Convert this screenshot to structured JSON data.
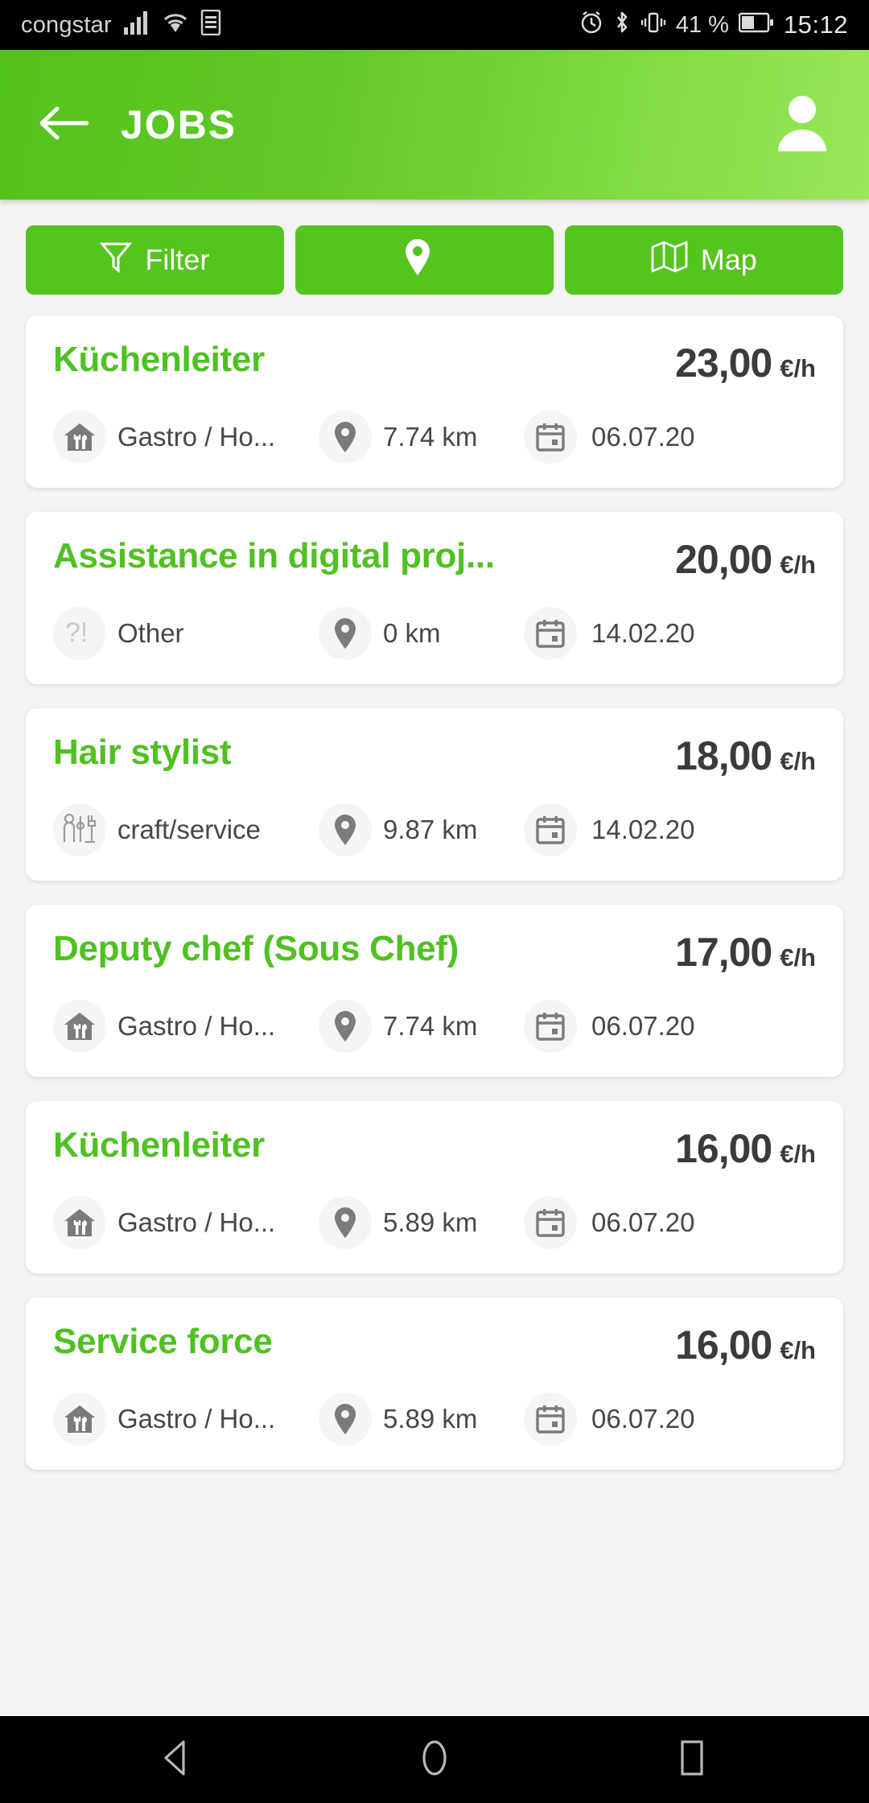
{
  "statusbar": {
    "carrier": "congstar",
    "battery_percent": "41 %",
    "clock": "15:12",
    "icons": [
      "signal-bars-icon",
      "wifi-icon",
      "sim-card-icon",
      "alarm-icon",
      "bluetooth-icon",
      "vibrate-icon",
      "battery-icon"
    ]
  },
  "appbar": {
    "title": "JOBS",
    "back_icon": "back-arrow-icon",
    "profile_icon": "person-icon"
  },
  "toolbar": {
    "filter_label": "Filter",
    "filter_icon": "funnel-icon",
    "location_icon": "map-pin-icon",
    "location_label": "",
    "map_label": "Map",
    "map_icon": "folded-map-icon"
  },
  "colors": {
    "brand_green": "#55c41f",
    "title_green": "#4fc122",
    "appbar_gradient_start": "#54c21c",
    "appbar_gradient_end": "#9ae75a",
    "price_text": "#3b3b3b",
    "meta_text": "#474747",
    "page_background": "#f4f4f4",
    "card_background": "#ffffff"
  },
  "jobs": [
    {
      "title": "Küchenleiter",
      "price": "23,00",
      "unit": "€/h",
      "category": "Gastro / Ho...",
      "category_icon": "gastro-house-icon",
      "distance": "7.74 km",
      "distance_icon": "map-pin-icon",
      "date": "06.07.20",
      "date_icon": "calendar-icon"
    },
    {
      "title": "Assistance in digital proj...",
      "price": "20,00",
      "unit": "€/h",
      "category": "Other",
      "category_icon": "question-exclamation-icon",
      "distance": "0 km",
      "distance_icon": "map-pin-icon",
      "date": "14.02.20",
      "date_icon": "calendar-icon"
    },
    {
      "title": "Hair stylist",
      "price": "18,00",
      "unit": "€/h",
      "category": "craft/service",
      "category_icon": "craft-worker-icon",
      "distance": "9.87 km",
      "distance_icon": "map-pin-icon",
      "date": "14.02.20",
      "date_icon": "calendar-icon"
    },
    {
      "title": "Deputy chef (Sous Chef)",
      "price": "17,00",
      "unit": "€/h",
      "category": "Gastro / Ho...",
      "category_icon": "gastro-house-icon",
      "distance": "7.74 km",
      "distance_icon": "map-pin-icon",
      "date": "06.07.20",
      "date_icon": "calendar-icon"
    },
    {
      "title": "Küchenleiter",
      "price": "16,00",
      "unit": "€/h",
      "category": "Gastro / Ho...",
      "category_icon": "gastro-house-icon",
      "distance": "5.89 km",
      "distance_icon": "map-pin-icon",
      "date": "06.07.20",
      "date_icon": "calendar-icon"
    },
    {
      "title": "Service force",
      "price": "16,00",
      "unit": "€/h",
      "category": "Gastro / Ho...",
      "category_icon": "gastro-house-icon",
      "distance": "5.89 km",
      "distance_icon": "map-pin-icon",
      "date": "06.07.20",
      "date_icon": "calendar-icon"
    }
  ],
  "navbar": {
    "back_icon": "nav-back-triangle-icon",
    "home_icon": "nav-home-circle-icon",
    "recents_icon": "nav-recents-square-icon"
  }
}
